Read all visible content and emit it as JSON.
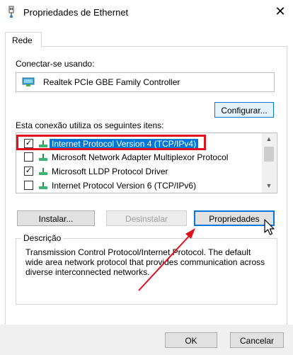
{
  "window": {
    "title": "Propriedades de Ethernet"
  },
  "tabs": [
    {
      "label": "Rede"
    }
  ],
  "connect_using_label": "Conectar-se usando:",
  "adapter_name": "Realtek PCIe GBE Family Controller",
  "configure_label": "Configurar...",
  "items_label": "Esta conexão utiliza os seguintes itens:",
  "items": [
    {
      "label": "Internet Protocol Version 4 (TCP/IPv4)",
      "checked": true,
      "selected": true
    },
    {
      "label": "Microsoft Network Adapter Multiplexor Protocol",
      "checked": false,
      "selected": false
    },
    {
      "label": "Microsoft LLDP Protocol Driver",
      "checked": true,
      "selected": false
    },
    {
      "label": "Internet Protocol Version 6 (TCP/IPv6)",
      "checked": false,
      "selected": false
    }
  ],
  "buttons": {
    "install": "Instalar...",
    "uninstall": "Desinstalar",
    "properties": "Propriedades",
    "ok": "OK",
    "cancel": "Cancelar"
  },
  "description": {
    "label": "Descrição",
    "text": "Transmission Control Protocol/Internet Protocol. The default wide area network protocol that provides communication across diverse interconnected networks."
  },
  "colors": {
    "accent": "#0078d7",
    "annotation": "#e0101e"
  },
  "icons": {
    "title": "network-adapter-icon",
    "close": "close-icon",
    "cursor": "mouse-pointer-icon"
  }
}
